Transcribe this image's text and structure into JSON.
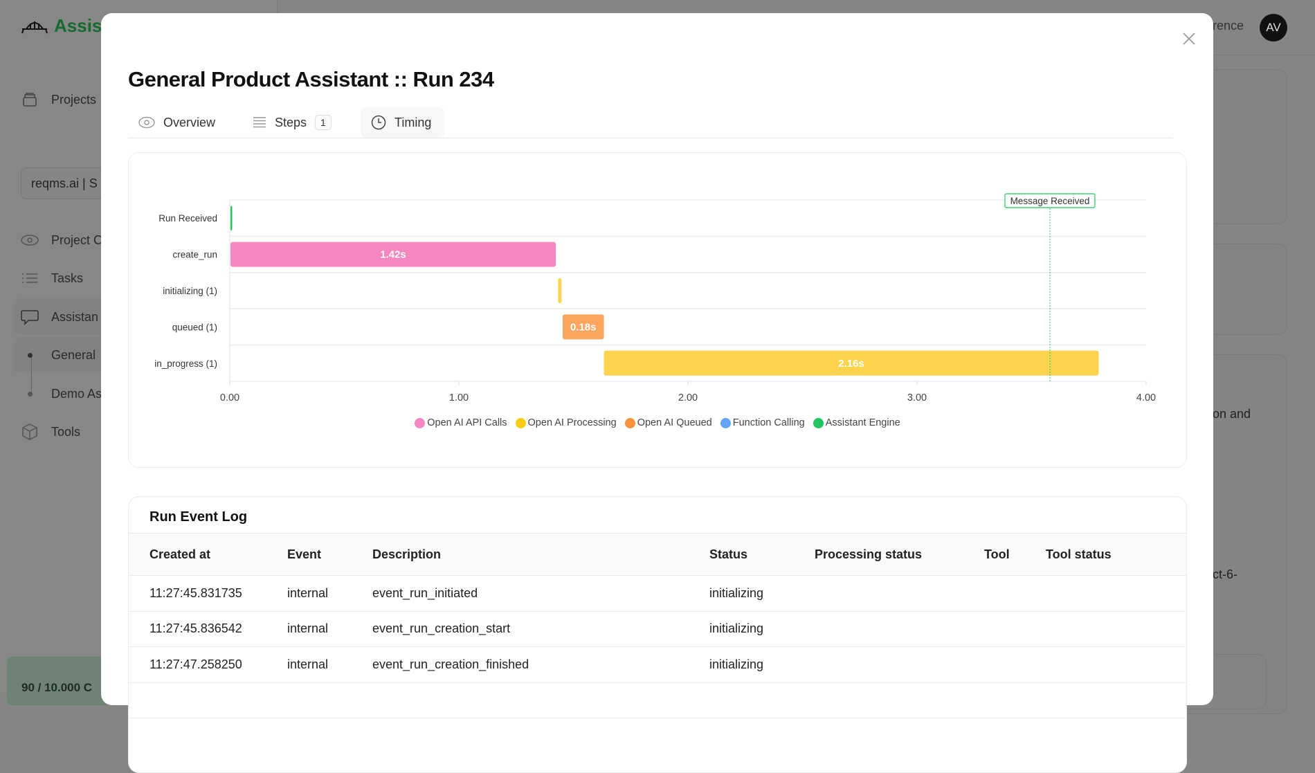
{
  "background": {
    "logo_text": "Assist",
    "sidebar": {
      "items": [
        {
          "label": "Projects",
          "icon": "archive-icon"
        },
        {
          "label": "Project C",
          "icon": "eye-icon"
        },
        {
          "label": "Tasks",
          "icon": "list-icon"
        },
        {
          "label": "Assistan",
          "icon": "message-icon"
        },
        {
          "label": "General",
          "icon": "dot-icon"
        },
        {
          "label": "Demo As",
          "icon": "dot-icon"
        },
        {
          "label": "Tools",
          "icon": "box-icon"
        }
      ],
      "project_select": "reqms.ai | S",
      "quota": "90 / 10.000 C"
    },
    "topbar_link": "rence",
    "avatar": "AV",
    "card_text_1": "on and",
    "card_text_2": "ct-6-"
  },
  "modal": {
    "title": "General Product Assistant :: Run 234",
    "tabs": [
      {
        "label": "Overview",
        "icon": "eye-icon"
      },
      {
        "label": "Steps",
        "icon": "list-icon",
        "badge": "1"
      },
      {
        "label": "Timing",
        "icon": "clock-icon",
        "active": true
      }
    ]
  },
  "chart_data": {
    "type": "bar",
    "orientation": "horizontal-gantt",
    "categories": [
      "Run Received",
      "create_run",
      "initializing (1)",
      "queued (1)",
      "in_progress (1)"
    ],
    "bars": [
      {
        "category": "Run Received",
        "start": 0.0,
        "duration": 0.005,
        "series": "Assistant Engine",
        "label": ""
      },
      {
        "category": "create_run",
        "start": 0.0,
        "duration": 1.42,
        "series": "Open AI API Calls",
        "label": "1.42s"
      },
      {
        "category": "initializing (1)",
        "start": 1.43,
        "duration": 0.015,
        "series": "Open AI Processing",
        "label": ""
      },
      {
        "category": "queued (1)",
        "start": 1.45,
        "duration": 0.18,
        "series": "Open AI Queued",
        "label": "0.18s"
      },
      {
        "category": "in_progress (1)",
        "start": 1.63,
        "duration": 2.16,
        "series": "Open AI Processing",
        "label": "2.16s"
      }
    ],
    "marker": {
      "label": "Message Received",
      "x": 3.58
    },
    "xlim": [
      0,
      4
    ],
    "xticks": [
      "0.00",
      "1.00",
      "2.00",
      "3.00",
      "4.00"
    ],
    "grid": true,
    "legend_position": "bottom",
    "legend": [
      {
        "name": "Open AI API Calls",
        "color": "#f687c0"
      },
      {
        "name": "Open AI Processing",
        "color": "#facc15"
      },
      {
        "name": "Open AI Queued",
        "color": "#fb923c"
      },
      {
        "name": "Function Calling",
        "color": "#60a5fa"
      },
      {
        "name": "Assistant Engine",
        "color": "#22c55e"
      }
    ]
  },
  "event_log": {
    "title": "Run Event Log",
    "columns": [
      "Created at",
      "Event",
      "Description",
      "Status",
      "Processing status",
      "Tool",
      "Tool status"
    ],
    "rows": [
      [
        "11:27:45.831735",
        "internal",
        "event_run_initiated",
        "initializing",
        "",
        "",
        ""
      ],
      [
        "11:27:45.836542",
        "internal",
        "event_run_creation_start",
        "initializing",
        "",
        "",
        ""
      ],
      [
        "11:27:47.258250",
        "internal",
        "event_run_creation_finished",
        "initializing",
        "",
        "",
        ""
      ],
      [
        "",
        "",
        "",
        "",
        "",
        "",
        ""
      ]
    ]
  }
}
